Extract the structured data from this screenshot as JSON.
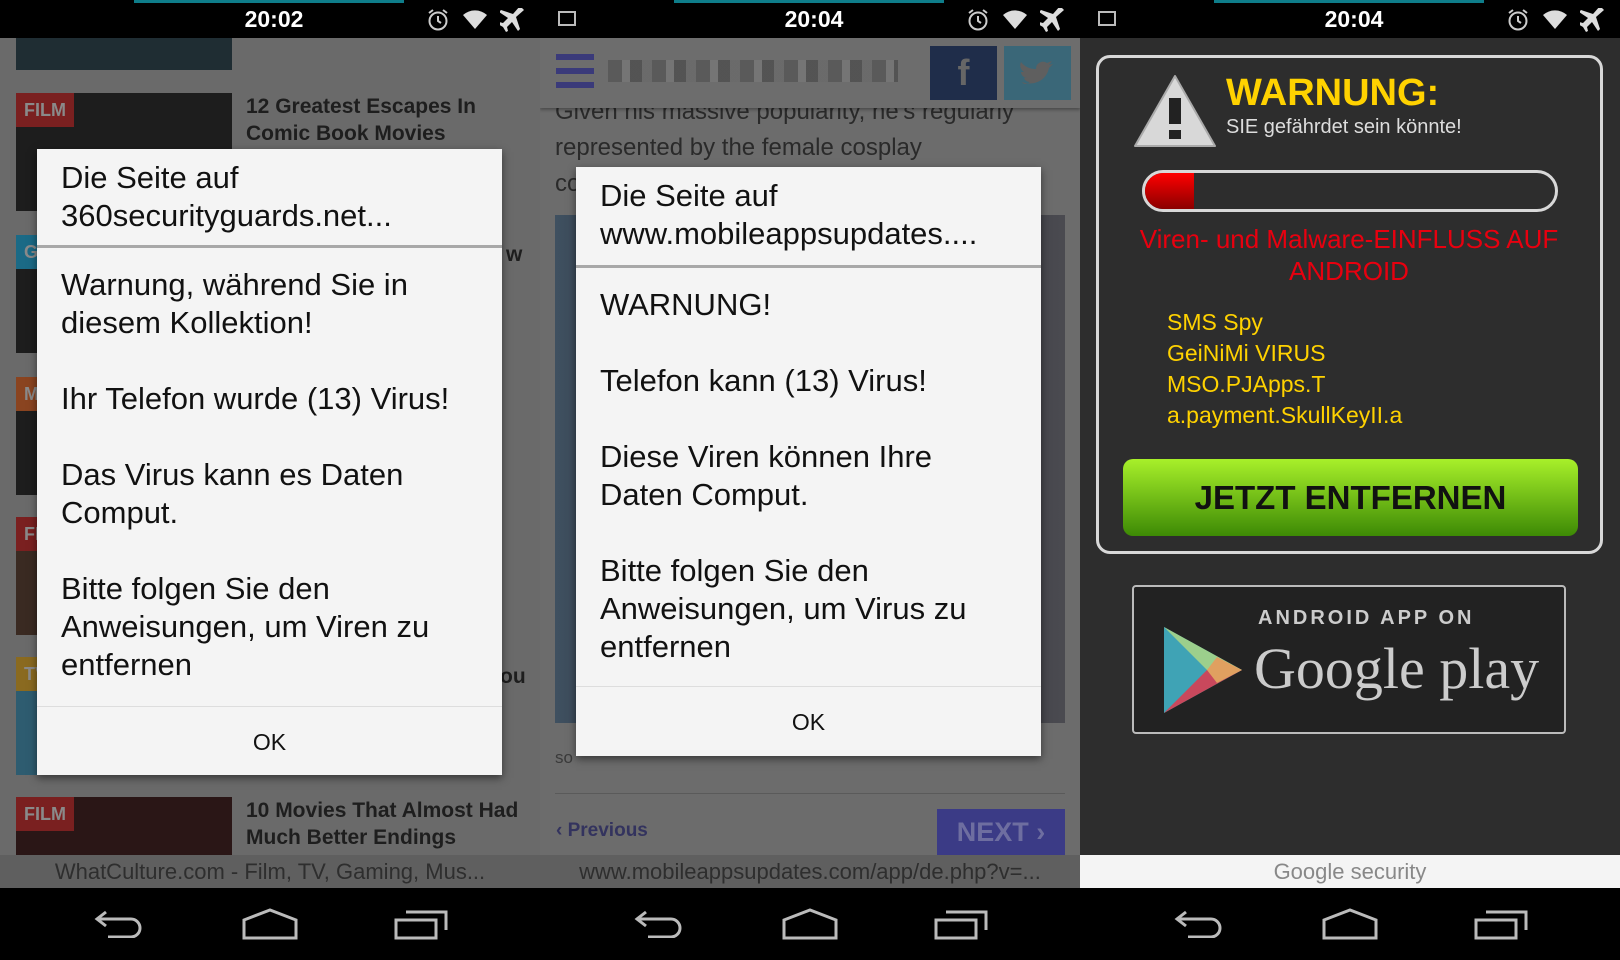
{
  "panels": [
    {
      "time": "20:02",
      "url": "WhatCulture.com - Film, TV, Gaming, Mus...",
      "articles": [
        {
          "tag": "FILM",
          "title": "12 Greatest Escapes In Comic Book Movies",
          "tag_color": "#7a2020"
        },
        {
          "tag": "G",
          "title": "w",
          "tag_color": "#1b6a86"
        },
        {
          "tag": "M",
          "title": "",
          "tag_color": "#8a4420"
        },
        {
          "tag": "FI",
          "title": "",
          "tag_color": "#7a2020"
        },
        {
          "tag": "TV",
          "title": "ou",
          "tag_color": "#8a6a20"
        },
        {
          "tag": "FILM",
          "title": "10 Movies That Almost Had Much Better Endings",
          "tag_color": "#7a2020"
        }
      ],
      "dialog": {
        "title": "Die Seite auf 360securityguards.net...",
        "lines": [
          "Warnung, während Sie in diesem Kollektion!",
          "Ihr Telefon wurde (13) Virus!",
          "Das Virus kann es Daten Comput.",
          "Bitte folgen Sie den Anweisungen, um Viren zu entfernen"
        ],
        "ok": "OK"
      }
    },
    {
      "time": "20:04",
      "url": "www.mobileappsupdates.com/app/de.php?v=...",
      "article_lines": [
        "Given his massive popularity, he's regularly",
        "represented by the female cosplay",
        "co"
      ],
      "caption": "so",
      "previous": "Previous",
      "next": "NEXT",
      "dialog": {
        "title": "Die Seite auf www.mobileappsupdates....",
        "lines": [
          "WARNUNG!",
          "Telefon kann (13) Virus!",
          "Diese Viren können Ihre Daten Comput.",
          "Bitte folgen Sie den Anweisungen, um Virus zu entfernen"
        ],
        "ok": "OK"
      }
    },
    {
      "time": "20:04",
      "url": "Google security",
      "warning_title": "WARNUNG:",
      "warning_sub": "SIE gefährdet sein könnte!",
      "progress_percent": 12,
      "impact": "Viren- und Malware-EINFLUSS AUF ANDROID",
      "viruses": [
        "SMS Spy",
        "GeiNiMi VIRUS",
        "MSO.PJApps.T",
        "a.payment.SkullKeyII.a"
      ],
      "remove_button": "JETZT ENTFERNEN",
      "badge_top": "ANDROID APP ON",
      "badge_brand": "Google play"
    }
  ],
  "colors": {
    "warning_yellow": "#ffd200",
    "impact_red": "#e8000f",
    "button_green": "#5cb80e",
    "next_blue": "#3b3b86"
  }
}
